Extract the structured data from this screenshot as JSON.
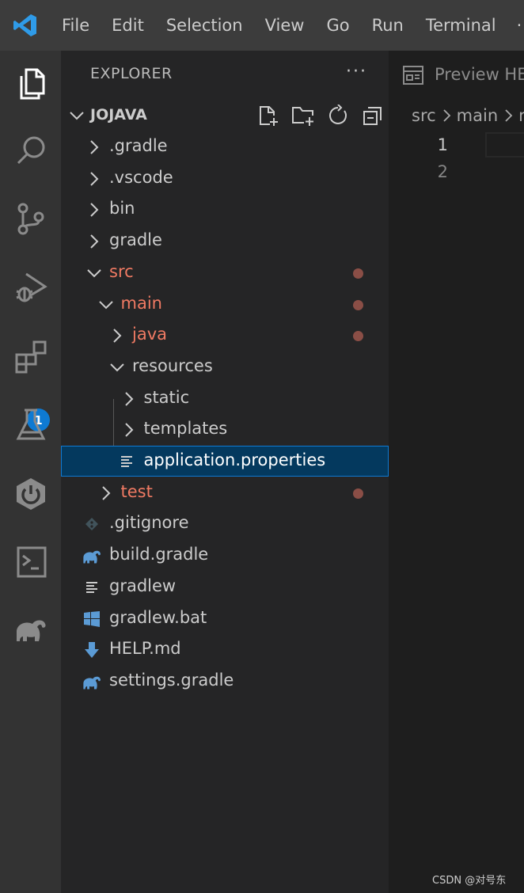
{
  "menu": {
    "items": [
      "File",
      "Edit",
      "Selection",
      "View",
      "Go",
      "Run",
      "Terminal"
    ],
    "overflow": "·"
  },
  "activity_bar": {
    "icons": [
      "explorer-icon",
      "search-icon",
      "source-control-icon",
      "run-debug-icon",
      "extensions-icon",
      "testing-icon",
      "spring-boot-icon",
      "terminal-icon",
      "gradle-icon"
    ],
    "extensions_badge": "1"
  },
  "sidebar": {
    "header": "EXPLORER",
    "more": "···",
    "section_title": "JOJAVA",
    "tree": [
      {
        "label": ".gradle",
        "type": "folder",
        "expanded": false,
        "depth": 0,
        "modified": false
      },
      {
        "label": ".vscode",
        "type": "folder",
        "expanded": false,
        "depth": 0,
        "modified": false
      },
      {
        "label": "bin",
        "type": "folder",
        "expanded": false,
        "depth": 0,
        "modified": false
      },
      {
        "label": "gradle",
        "type": "folder",
        "expanded": false,
        "depth": 0,
        "modified": false
      },
      {
        "label": "src",
        "type": "folder",
        "expanded": true,
        "depth": 0,
        "modified": true
      },
      {
        "label": "main",
        "type": "folder",
        "expanded": true,
        "depth": 1,
        "modified": true
      },
      {
        "label": "java",
        "type": "folder",
        "expanded": false,
        "depth": 2,
        "modified": true
      },
      {
        "label": "resources",
        "type": "folder",
        "expanded": true,
        "depth": 2,
        "modified": false
      },
      {
        "label": "static",
        "type": "folder",
        "expanded": false,
        "depth": 3,
        "modified": false
      },
      {
        "label": "templates",
        "type": "folder",
        "expanded": false,
        "depth": 3,
        "modified": false
      },
      {
        "label": "application.properties",
        "type": "file",
        "icon": "lines-icon",
        "depth": 3,
        "modified": false,
        "selected": true
      },
      {
        "label": "test",
        "type": "folder",
        "expanded": false,
        "depth": 1,
        "modified": true
      },
      {
        "label": ".gitignore",
        "type": "file",
        "icon": "git-icon",
        "depth": 0,
        "modified": false
      },
      {
        "label": "build.gradle",
        "type": "file",
        "icon": "elephant-icon",
        "depth": 0,
        "modified": false
      },
      {
        "label": "gradlew",
        "type": "file",
        "icon": "lines-icon",
        "depth": 0,
        "modified": false
      },
      {
        "label": "gradlew.bat",
        "type": "file",
        "icon": "windows-icon",
        "depth": 0,
        "modified": false
      },
      {
        "label": "HELP.md",
        "type": "file",
        "icon": "download-arrow-icon",
        "depth": 0,
        "modified": false
      },
      {
        "label": "settings.gradle",
        "type": "file",
        "icon": "elephant-icon",
        "depth": 0,
        "modified": false
      }
    ]
  },
  "editor": {
    "tab_label": "Preview HE",
    "breadcrumb": [
      "src",
      "main",
      "r"
    ],
    "line_numbers": [
      "1",
      "2"
    ]
  },
  "watermark": "CSDN @对号东",
  "colors": {
    "accent": "#0e7ad3",
    "modified": "#f07a63",
    "selected_bg": "#04395e",
    "gradle_blue": "#5b9bd5"
  }
}
